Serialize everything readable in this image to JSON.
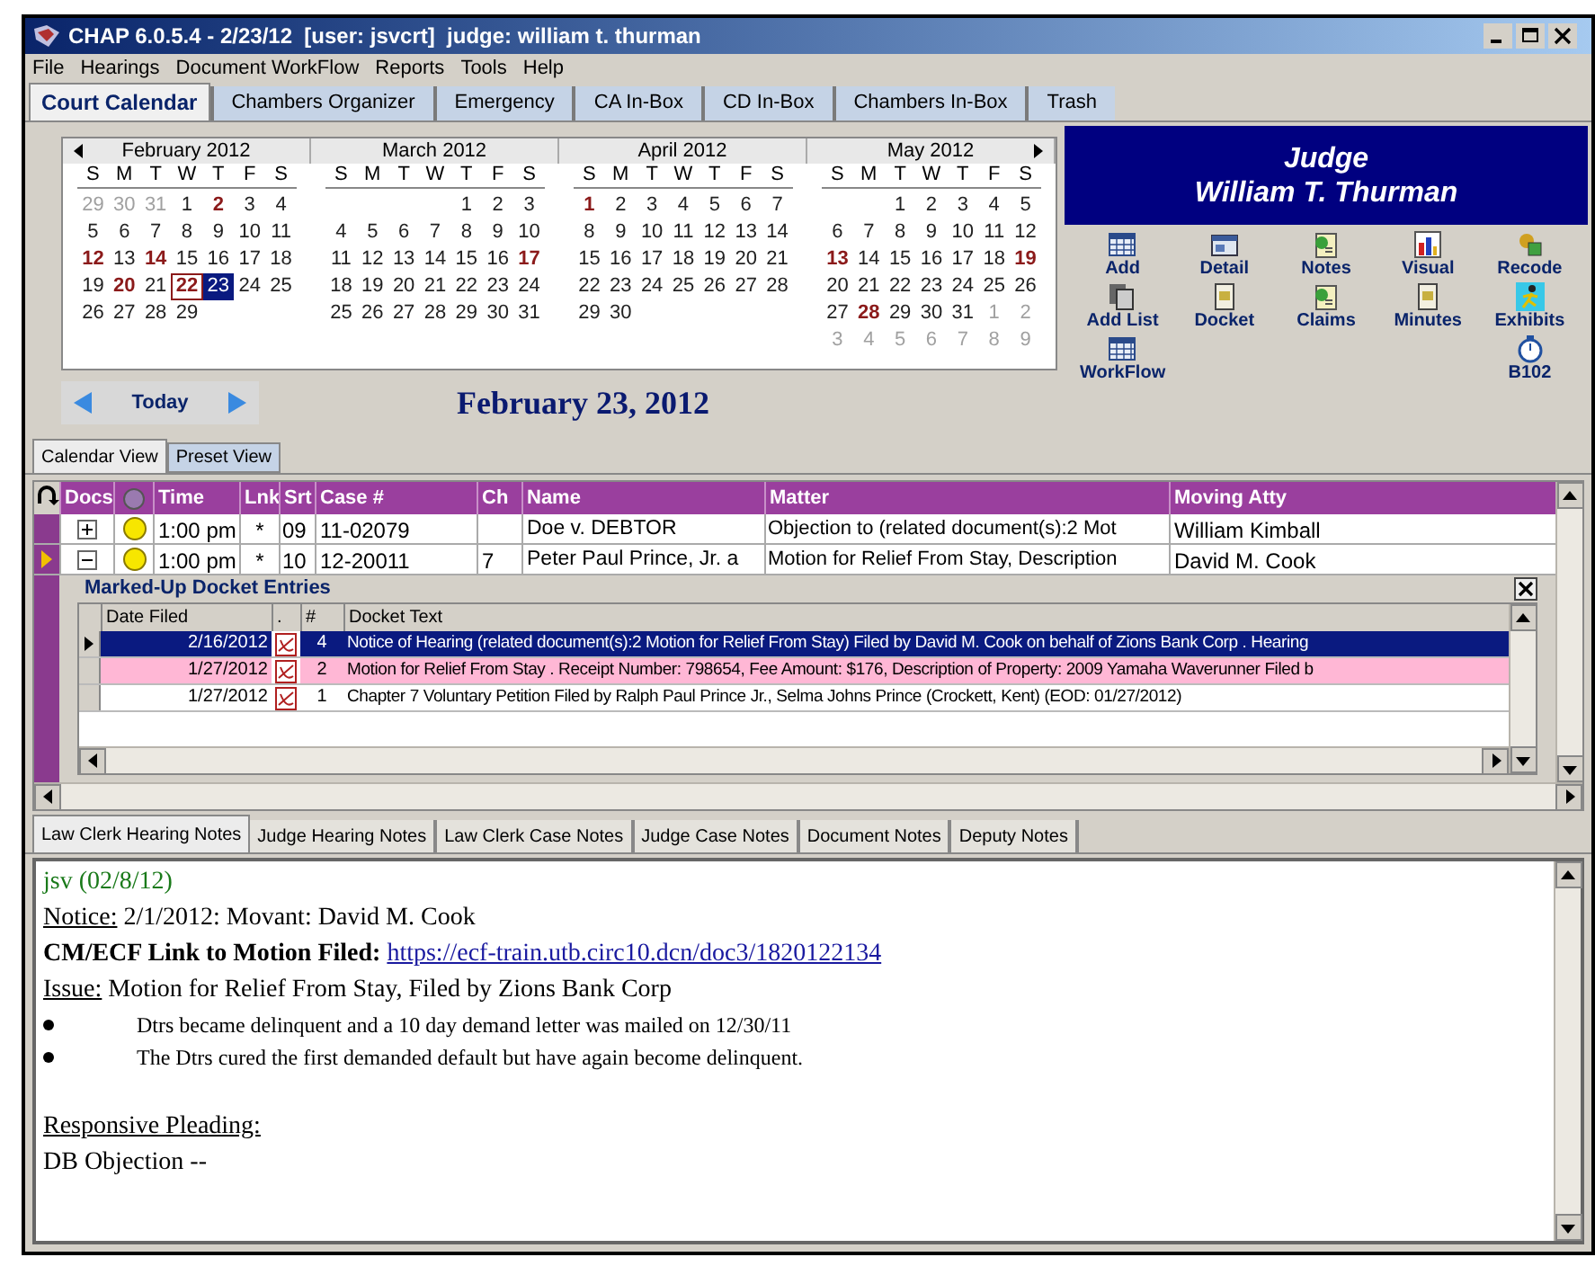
{
  "window": {
    "title": "CHAP 6.0.5.4 - 2/23/12  [user: jsvcrt]  judge: william t. thurman"
  },
  "menu": [
    "File",
    "Hearings",
    "Document WorkFlow",
    "Reports",
    "Tools",
    "Help"
  ],
  "tabs": [
    {
      "label": "Court Calendar",
      "selected": true
    },
    {
      "label": "Chambers Organizer",
      "selected": false
    },
    {
      "label": "Emergency",
      "selected": false
    },
    {
      "label": "CA In-Box",
      "selected": false
    },
    {
      "label": "CD In-Box",
      "selected": false
    },
    {
      "label": "Chambers In-Box",
      "selected": false
    },
    {
      "label": "Trash",
      "selected": false
    }
  ],
  "calendar": {
    "months": [
      {
        "title": "February 2012",
        "weekdays": [
          "S",
          "M",
          "T",
          "W",
          "T",
          "F",
          "S"
        ],
        "weeks": [
          [
            {
              "d": "29",
              "kind": "other"
            },
            {
              "d": "30",
              "kind": "other"
            },
            {
              "d": "31",
              "kind": "other"
            },
            {
              "d": "1",
              "kind": "normal"
            },
            {
              "d": "2",
              "kind": "marked"
            },
            {
              "d": "3",
              "kind": "normal"
            },
            {
              "d": "4",
              "kind": "normal"
            }
          ],
          [
            {
              "d": "5",
              "kind": "normal"
            },
            {
              "d": "6",
              "kind": "normal"
            },
            {
              "d": "7",
              "kind": "normal"
            },
            {
              "d": "8",
              "kind": "normal"
            },
            {
              "d": "9",
              "kind": "normal"
            },
            {
              "d": "10",
              "kind": "normal"
            },
            {
              "d": "11",
              "kind": "normal"
            }
          ],
          [
            {
              "d": "12",
              "kind": "marked"
            },
            {
              "d": "13",
              "kind": "normal"
            },
            {
              "d": "14",
              "kind": "marked"
            },
            {
              "d": "15",
              "kind": "normal"
            },
            {
              "d": "16",
              "kind": "normal"
            },
            {
              "d": "17",
              "kind": "normal"
            },
            {
              "d": "18",
              "kind": "normal"
            }
          ],
          [
            {
              "d": "19",
              "kind": "normal"
            },
            {
              "d": "20",
              "kind": "marked"
            },
            {
              "d": "21",
              "kind": "normal"
            },
            {
              "d": "22",
              "kind": "outlined"
            },
            {
              "d": "23",
              "kind": "selected"
            },
            {
              "d": "24",
              "kind": "normal"
            },
            {
              "d": "25",
              "kind": "normal"
            }
          ],
          [
            {
              "d": "26",
              "kind": "normal"
            },
            {
              "d": "27",
              "kind": "normal"
            },
            {
              "d": "28",
              "kind": "normal"
            },
            {
              "d": "29",
              "kind": "normal"
            }
          ]
        ]
      },
      {
        "title": "March 2012",
        "weekdays": [
          "S",
          "M",
          "T",
          "W",
          "T",
          "F",
          "S"
        ],
        "weeks": [
          [
            {
              "kind": "blank"
            },
            {
              "kind": "blank"
            },
            {
              "kind": "blank"
            },
            {
              "kind": "blank"
            },
            {
              "d": "1",
              "kind": "normal"
            },
            {
              "d": "2",
              "kind": "normal"
            },
            {
              "d": "3",
              "kind": "normal"
            }
          ],
          [
            {
              "d": "4",
              "kind": "normal"
            },
            {
              "d": "5",
              "kind": "normal"
            },
            {
              "d": "6",
              "kind": "normal"
            },
            {
              "d": "7",
              "kind": "normal"
            },
            {
              "d": "8",
              "kind": "normal"
            },
            {
              "d": "9",
              "kind": "normal"
            },
            {
              "d": "10",
              "kind": "normal"
            }
          ],
          [
            {
              "d": "11",
              "kind": "normal"
            },
            {
              "d": "12",
              "kind": "normal"
            },
            {
              "d": "13",
              "kind": "normal"
            },
            {
              "d": "14",
              "kind": "normal"
            },
            {
              "d": "15",
              "kind": "normal"
            },
            {
              "d": "16",
              "kind": "normal"
            },
            {
              "d": "17",
              "kind": "marked"
            }
          ],
          [
            {
              "d": "18",
              "kind": "normal"
            },
            {
              "d": "19",
              "kind": "normal"
            },
            {
              "d": "20",
              "kind": "normal"
            },
            {
              "d": "21",
              "kind": "normal"
            },
            {
              "d": "22",
              "kind": "normal"
            },
            {
              "d": "23",
              "kind": "normal"
            },
            {
              "d": "24",
              "kind": "normal"
            }
          ],
          [
            {
              "d": "25",
              "kind": "normal"
            },
            {
              "d": "26",
              "kind": "normal"
            },
            {
              "d": "27",
              "kind": "normal"
            },
            {
              "d": "28",
              "kind": "normal"
            },
            {
              "d": "29",
              "kind": "normal"
            },
            {
              "d": "30",
              "kind": "normal"
            },
            {
              "d": "31",
              "kind": "normal"
            }
          ]
        ]
      },
      {
        "title": "April 2012",
        "weekdays": [
          "S",
          "M",
          "T",
          "W",
          "T",
          "F",
          "S"
        ],
        "weeks": [
          [
            {
              "d": "1",
              "kind": "marked"
            },
            {
              "d": "2",
              "kind": "normal"
            },
            {
              "d": "3",
              "kind": "normal"
            },
            {
              "d": "4",
              "kind": "normal"
            },
            {
              "d": "5",
              "kind": "normal"
            },
            {
              "d": "6",
              "kind": "normal"
            },
            {
              "d": "7",
              "kind": "normal"
            }
          ],
          [
            {
              "d": "8",
              "kind": "normal"
            },
            {
              "d": "9",
              "kind": "normal"
            },
            {
              "d": "10",
              "kind": "normal"
            },
            {
              "d": "11",
              "kind": "normal"
            },
            {
              "d": "12",
              "kind": "normal"
            },
            {
              "d": "13",
              "kind": "normal"
            },
            {
              "d": "14",
              "kind": "normal"
            }
          ],
          [
            {
              "d": "15",
              "kind": "normal"
            },
            {
              "d": "16",
              "kind": "normal"
            },
            {
              "d": "17",
              "kind": "normal"
            },
            {
              "d": "18",
              "kind": "normal"
            },
            {
              "d": "19",
              "kind": "normal"
            },
            {
              "d": "20",
              "kind": "normal"
            },
            {
              "d": "21",
              "kind": "normal"
            }
          ],
          [
            {
              "d": "22",
              "kind": "normal"
            },
            {
              "d": "23",
              "kind": "normal"
            },
            {
              "d": "24",
              "kind": "normal"
            },
            {
              "d": "25",
              "kind": "normal"
            },
            {
              "d": "26",
              "kind": "normal"
            },
            {
              "d": "27",
              "kind": "normal"
            },
            {
              "d": "28",
              "kind": "normal"
            }
          ],
          [
            {
              "d": "29",
              "kind": "normal"
            },
            {
              "d": "30",
              "kind": "normal"
            }
          ]
        ]
      },
      {
        "title": "May 2012",
        "weekdays": [
          "S",
          "M",
          "T",
          "W",
          "T",
          "F",
          "S"
        ],
        "weeks": [
          [
            {
              "kind": "blank"
            },
            {
              "kind": "blank"
            },
            {
              "d": "1",
              "kind": "normal"
            },
            {
              "d": "2",
              "kind": "normal"
            },
            {
              "d": "3",
              "kind": "normal"
            },
            {
              "d": "4",
              "kind": "normal"
            },
            {
              "d": "5",
              "kind": "normal"
            }
          ],
          [
            {
              "d": "6",
              "kind": "normal"
            },
            {
              "d": "7",
              "kind": "normal"
            },
            {
              "d": "8",
              "kind": "normal"
            },
            {
              "d": "9",
              "kind": "normal"
            },
            {
              "d": "10",
              "kind": "normal"
            },
            {
              "d": "11",
              "kind": "normal"
            },
            {
              "d": "12",
              "kind": "normal"
            }
          ],
          [
            {
              "d": "13",
              "kind": "marked"
            },
            {
              "d": "14",
              "kind": "normal"
            },
            {
              "d": "15",
              "kind": "normal"
            },
            {
              "d": "16",
              "kind": "normal"
            },
            {
              "d": "17",
              "kind": "normal"
            },
            {
              "d": "18",
              "kind": "normal"
            },
            {
              "d": "19",
              "kind": "marked"
            }
          ],
          [
            {
              "d": "20",
              "kind": "normal"
            },
            {
              "d": "21",
              "kind": "normal"
            },
            {
              "d": "22",
              "kind": "normal"
            },
            {
              "d": "23",
              "kind": "normal"
            },
            {
              "d": "24",
              "kind": "normal"
            },
            {
              "d": "25",
              "kind": "normal"
            },
            {
              "d": "26",
              "kind": "normal"
            }
          ],
          [
            {
              "d": "27",
              "kind": "normal"
            },
            {
              "d": "28",
              "kind": "marked"
            },
            {
              "d": "29",
              "kind": "normal"
            },
            {
              "d": "30",
              "kind": "normal"
            },
            {
              "d": "31",
              "kind": "normal"
            },
            {
              "d": "1",
              "kind": "other"
            },
            {
              "d": "2",
              "kind": "other"
            }
          ],
          [
            {
              "d": "3",
              "kind": "other"
            },
            {
              "d": "4",
              "kind": "other"
            },
            {
              "d": "5",
              "kind": "other"
            },
            {
              "d": "6",
              "kind": "other"
            },
            {
              "d": "7",
              "kind": "other"
            },
            {
              "d": "8",
              "kind": "other"
            },
            {
              "d": "9",
              "kind": "other"
            }
          ]
        ]
      }
    ],
    "today_button": "Today",
    "current_date": "February 23, 2012"
  },
  "judge": {
    "title": "Judge",
    "name": "William T. Thurman"
  },
  "actions": [
    {
      "label": "Add",
      "kind": "grid"
    },
    {
      "label": "Detail",
      "kind": "card"
    },
    {
      "label": "Notes",
      "kind": "note"
    },
    {
      "label": "Visual",
      "kind": "chart"
    },
    {
      "label": "Recode",
      "kind": "tag"
    },
    {
      "label": "Add List",
      "kind": "stack"
    },
    {
      "label": "Docket",
      "kind": "doc"
    },
    {
      "label": "Claims",
      "kind": "note"
    },
    {
      "label": "Minutes",
      "kind": "doc"
    },
    {
      "label": "Exhibits",
      "kind": "figure"
    },
    {
      "label": "WorkFlow",
      "kind": "grid"
    },
    {
      "label": "B102",
      "kind": "clock"
    }
  ],
  "view_tabs": [
    {
      "label": "Calendar View",
      "selected": true
    },
    {
      "label": "Preset View",
      "selected": false
    }
  ],
  "grid": {
    "columns": [
      "Docs",
      "Time",
      "Lnk",
      "Srt",
      "Case #",
      "Ch",
      "Name",
      "Matter",
      "Moving Atty"
    ],
    "rows": [
      {
        "expanded": false,
        "selected": false,
        "time": "1:00 pm",
        "lnk": "*",
        "srt": "09",
        "case": "11-02079",
        "ch": "",
        "name": "Doe v. DEBTOR",
        "matter": "Objection to (related document(s):2 Mot",
        "atty": "William Kimball"
      },
      {
        "expanded": true,
        "selected": true,
        "time": "1:00 pm",
        "lnk": "*",
        "srt": "10",
        "case": "12-20011",
        "ch": "7",
        "name": "Peter Paul Prince, Jr. a",
        "matter": "Motion for Relief From Stay, Description",
        "atty": "David M. Cook"
      }
    ]
  },
  "docket": {
    "title": "Marked-Up Docket Entries",
    "columns": [
      "Date Filed",
      ".",
      "#",
      "Docket Text"
    ],
    "rows": [
      {
        "selected": true,
        "flagged": false,
        "date": "2/16/2012",
        "num": "4",
        "text": "Notice of Hearing (related document(s):2 Motion for Relief From Stay) Filed by David M. Cook on behalf of Zions Bank Corp . Hearing"
      },
      {
        "selected": false,
        "flagged": true,
        "date": "1/27/2012",
        "num": "2",
        "text": "Motion for Relief From Stay . Receipt Number: 798654, Fee Amount: $176, Description of Property: 2009 Yamaha Waverunner Filed b"
      },
      {
        "selected": false,
        "flagged": false,
        "date": "1/27/2012",
        "num": "1",
        "text": "Chapter 7 Voluntary Petition Filed by Ralph Paul Prince Jr., Selma Johns Prince (Crockett, Kent) (EOD: 01/27/2012)"
      }
    ]
  },
  "notes_tabs": [
    {
      "label": "Law Clerk Hearing Notes",
      "selected": true
    },
    {
      "label": "Judge Hearing Notes",
      "selected": false
    },
    {
      "label": "Law Clerk Case Notes",
      "selected": false
    },
    {
      "label": "Judge Case Notes",
      "selected": false
    },
    {
      "label": "Document Notes",
      "selected": false
    },
    {
      "label": "Deputy Notes",
      "selected": false
    }
  ],
  "notes": [
    {
      "kind": "author",
      "text": "jsv (02/8/12)"
    },
    {
      "kind": "labeled",
      "label": "Notice:",
      "text": " 2/1/2012: Movant: David M. Cook"
    },
    {
      "kind": "link",
      "label": "CM/ECF Link to Motion Filed:",
      "url": "https://ecf-train.utb.circ10.dcn/doc3/1820122134"
    },
    {
      "kind": "labeled",
      "label": "Issue:",
      "text": " Motion for Relief From Stay, Filed by Zions Bank Corp"
    },
    {
      "kind": "bullet",
      "text": "Dtrs became delinquent and a 10 day demand letter was mailed on 12/30/11"
    },
    {
      "kind": "bullet",
      "text": "The Dtrs cured the first demanded default but have again become delinquent."
    },
    {
      "kind": "heading",
      "text": "Responsive Pleading:"
    },
    {
      "kind": "plain",
      "text": "DB Objection --"
    }
  ]
}
